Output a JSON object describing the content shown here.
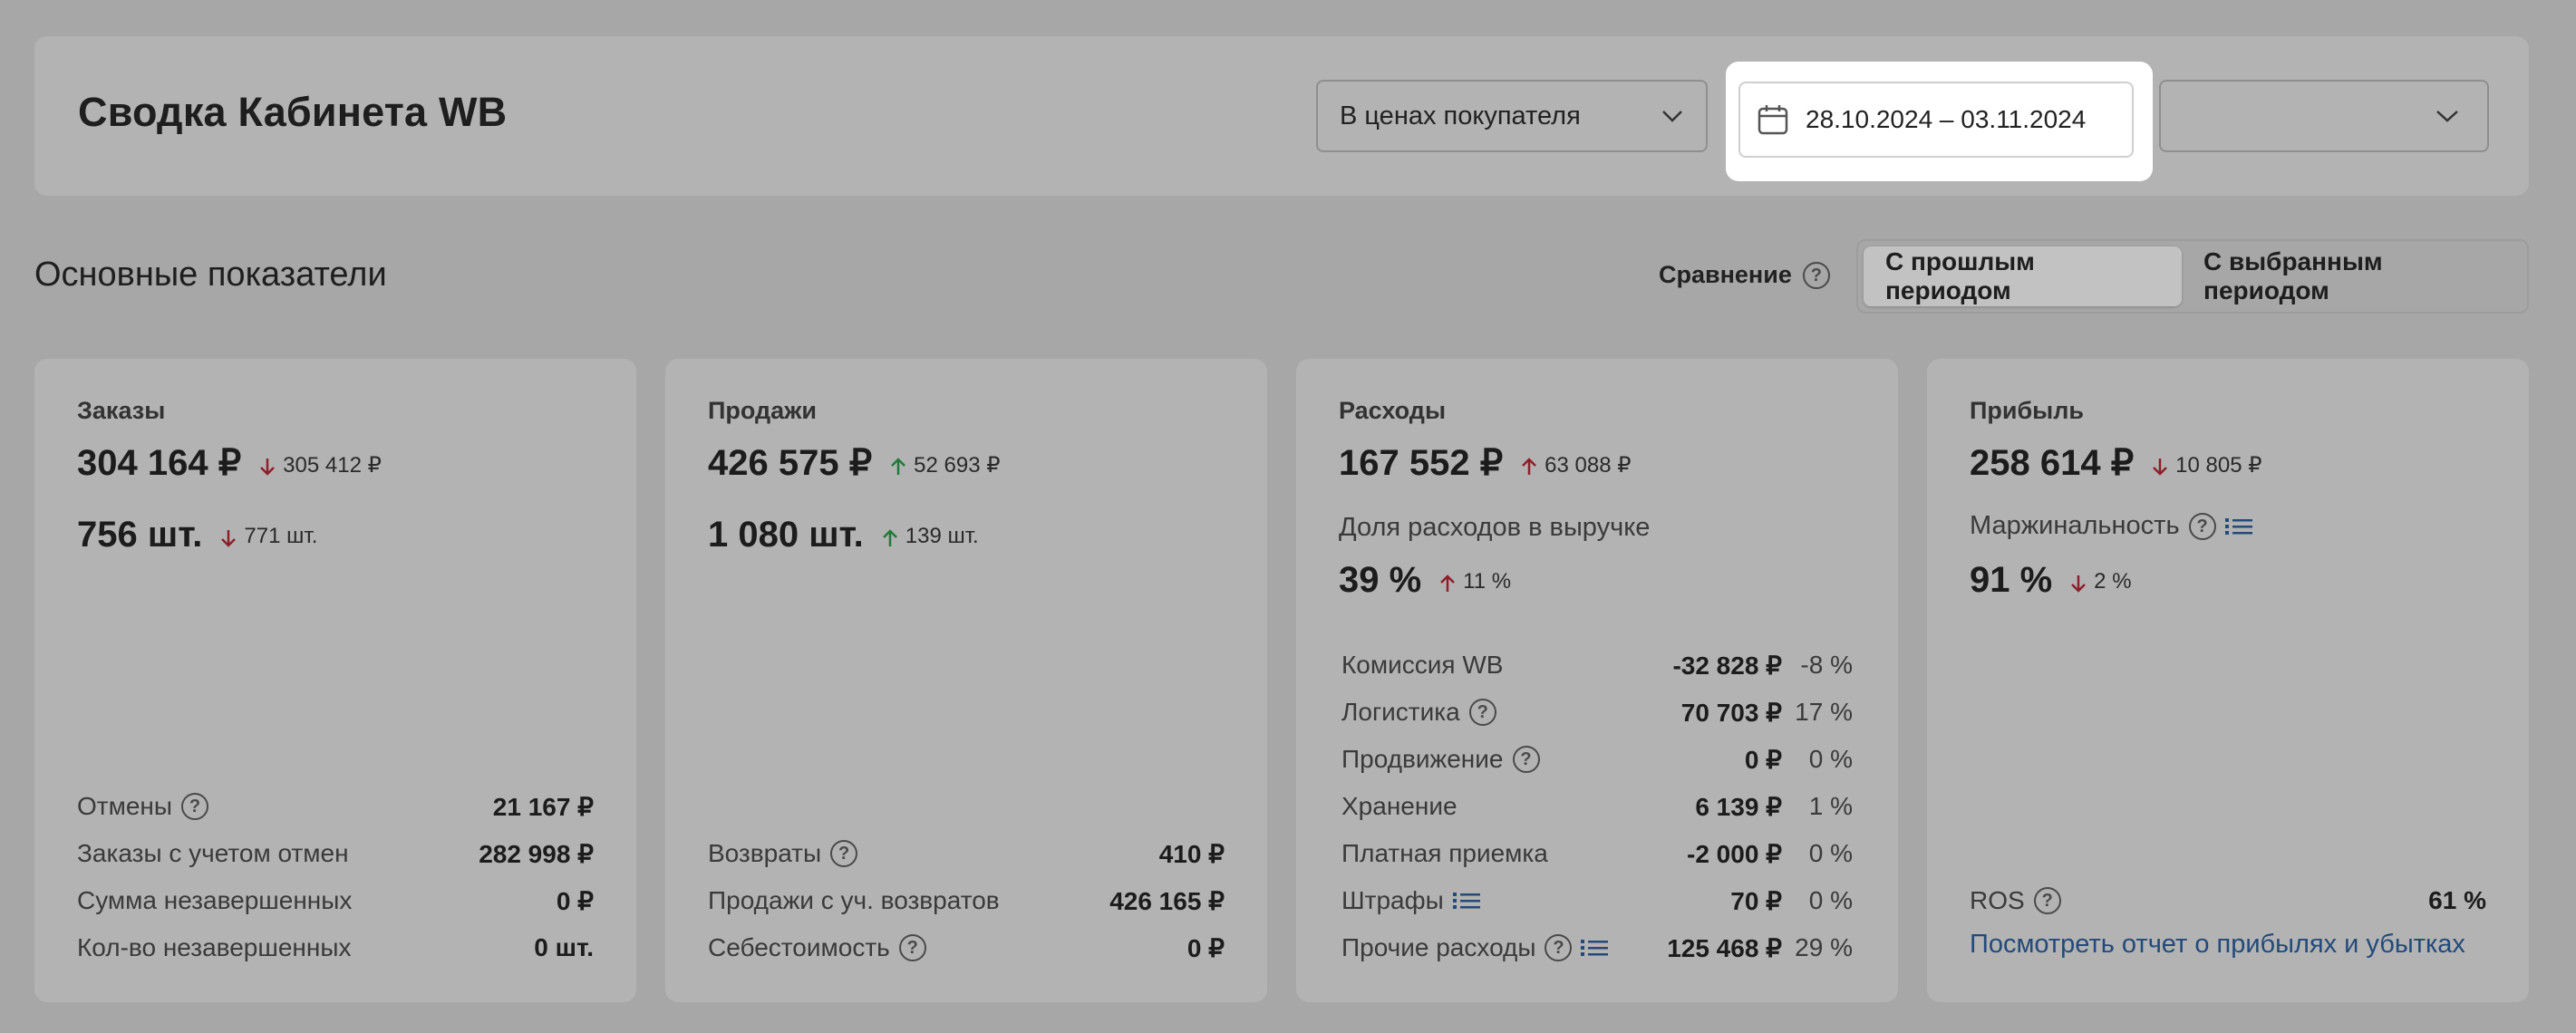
{
  "header": {
    "title": "Сводка Кабинета WB",
    "price_mode": "В ценах покупателя",
    "date_range": "28.10.2024 – 03.11.2024",
    "extra_select": ""
  },
  "section": {
    "title": "Основные показатели",
    "compare_label": "Сравнение",
    "tabs": [
      "С прошлым периодом",
      "С выбранным периодом"
    ]
  },
  "orders": {
    "label": "Заказы",
    "amount": "304 164 ₽",
    "amount_delta": "305 412 ₽",
    "count": "756 шт.",
    "count_delta": "771 шт.",
    "rows": [
      {
        "label": "Отмены",
        "value": "21 167 ₽"
      },
      {
        "label": "Заказы с учетом отмен",
        "value": "282 998 ₽"
      },
      {
        "label": "Сумма незавершенных",
        "value": "0 ₽"
      },
      {
        "label": "Кол-во незавершенных",
        "value": "0 шт."
      }
    ]
  },
  "sales": {
    "label": "Продажи",
    "amount": "426 575 ₽",
    "amount_delta": "52 693 ₽",
    "count": "1 080 шт.",
    "count_delta": "139 шт.",
    "rows": [
      {
        "label": "Возвраты",
        "value": "410 ₽"
      },
      {
        "label": "Продажи с уч. возвратов",
        "value": "426 165 ₽"
      },
      {
        "label": "Себестоимость",
        "value": "0 ₽"
      }
    ]
  },
  "expenses": {
    "label": "Расходы",
    "amount": "167 552 ₽",
    "amount_delta": "63 088 ₽",
    "share_label": "Доля расходов в выручке",
    "share": "39 %",
    "share_delta": "11 %",
    "rows": [
      {
        "label": "Комиссия WB",
        "value": "-32 828 ₽",
        "pct": "-8 %"
      },
      {
        "label": "Логистика",
        "value": "70 703 ₽",
        "pct": "17 %"
      },
      {
        "label": "Продвижение",
        "value": "0 ₽",
        "pct": "0 %"
      },
      {
        "label": "Хранение",
        "value": "6 139 ₽",
        "pct": "1 %"
      },
      {
        "label": "Платная приемка",
        "value": "-2 000 ₽",
        "pct": "0 %"
      },
      {
        "label": "Штрафы",
        "value": "70 ₽",
        "pct": "0 %"
      },
      {
        "label": "Прочие расходы",
        "value": "125 468 ₽",
        "pct": "29 %"
      }
    ]
  },
  "profit": {
    "label": "Прибыль",
    "amount": "258 614 ₽",
    "amount_delta": "10 805 ₽",
    "margin_label": "Маржинальность",
    "margin": "91 %",
    "margin_delta": "2 %",
    "ros_label": "ROS",
    "ros_value": "61 %",
    "report_link": "Посмотреть отчет о прибылях и убытках"
  },
  "colors": {
    "down_arrow": "#8e1f2a",
    "up_arrow": "#1f7a3a",
    "link": "#234a7a",
    "highlight": "#ffffff"
  }
}
